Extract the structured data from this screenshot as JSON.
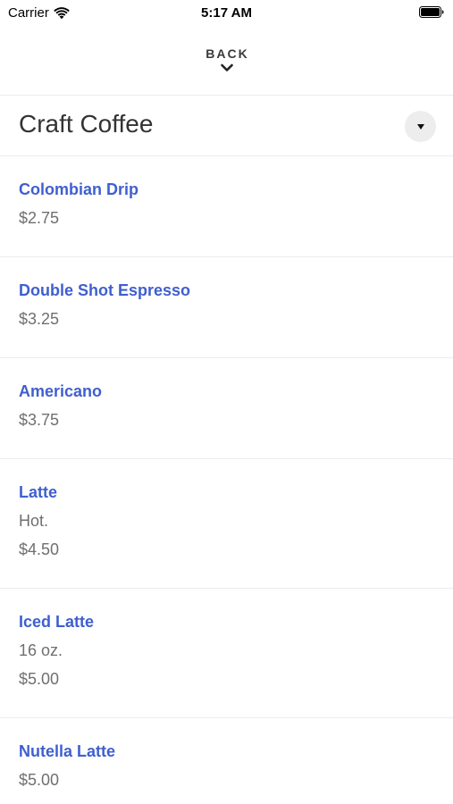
{
  "status_bar": {
    "carrier": "Carrier",
    "time": "5:17 AM",
    "wifi_icon": "wifi-icon",
    "battery_icon": "battery-icon"
  },
  "header": {
    "back_label": "BACK",
    "chevron_icon": "chevron-down-icon"
  },
  "category": {
    "title": "Craft Coffee",
    "dropdown_icon": "caret-down-icon"
  },
  "menu": {
    "items": [
      {
        "name": "Colombian Drip",
        "description": "",
        "price": "$2.75"
      },
      {
        "name": "Double Shot Espresso",
        "description": "",
        "price": "$3.25"
      },
      {
        "name": "Americano",
        "description": "",
        "price": "$3.75"
      },
      {
        "name": "Latte",
        "description": "Hot.",
        "price": "$4.50"
      },
      {
        "name": "Iced Latte",
        "description": "16 oz.",
        "price": "$5.00"
      },
      {
        "name": "Nutella Latte",
        "description": "",
        "price": "$5.00"
      }
    ]
  },
  "colors": {
    "accent": "#3f5fcf",
    "text_primary": "#333333",
    "text_secondary": "#6f6f6f",
    "divider": "#ececec"
  }
}
